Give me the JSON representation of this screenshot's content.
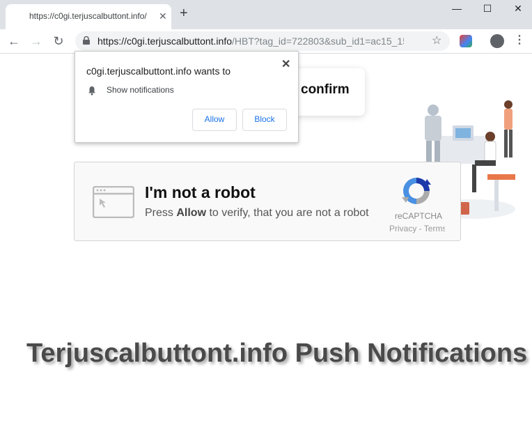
{
  "tab": {
    "title": "https://c0gi.terjuscalbuttont.info/",
    "close": "✕"
  },
  "window": {
    "minimize": "—",
    "maximize": "☐",
    "close": "✕",
    "newtab": "+"
  },
  "nav": {
    "back": "←",
    "forward": "→",
    "reload": "↻"
  },
  "omnibox": {
    "url_host": "https://c0gi.terjuscalbuttont.info",
    "url_path": "/HBT?tag_id=722803&sub_id1=ac15_159..."
  },
  "icons": {
    "star": "☆",
    "menu": "⋮"
  },
  "notification_prompt": {
    "title": "c0gi.terjuscalbuttont.info wants to",
    "item": "Show notifications",
    "allow": "Allow",
    "block": "Block",
    "close": "✕"
  },
  "page": {
    "confirm_text": "confirm",
    "captcha_title": "I'm not a robot",
    "captcha_sub_before": "Press ",
    "captcha_sub_bold": "Allow",
    "captcha_sub_after": " to verify, that you are not a robot",
    "recaptcha_label": "reCAPTCHA",
    "recaptcha_links": "Privacy - Terms"
  },
  "headline": "Terjuscalbuttont.info Push Notifications",
  "colors": {
    "accent": "#1a73e8",
    "tabstrip": "#dee1e6",
    "recaptcha_blue": "#4a90e2"
  }
}
